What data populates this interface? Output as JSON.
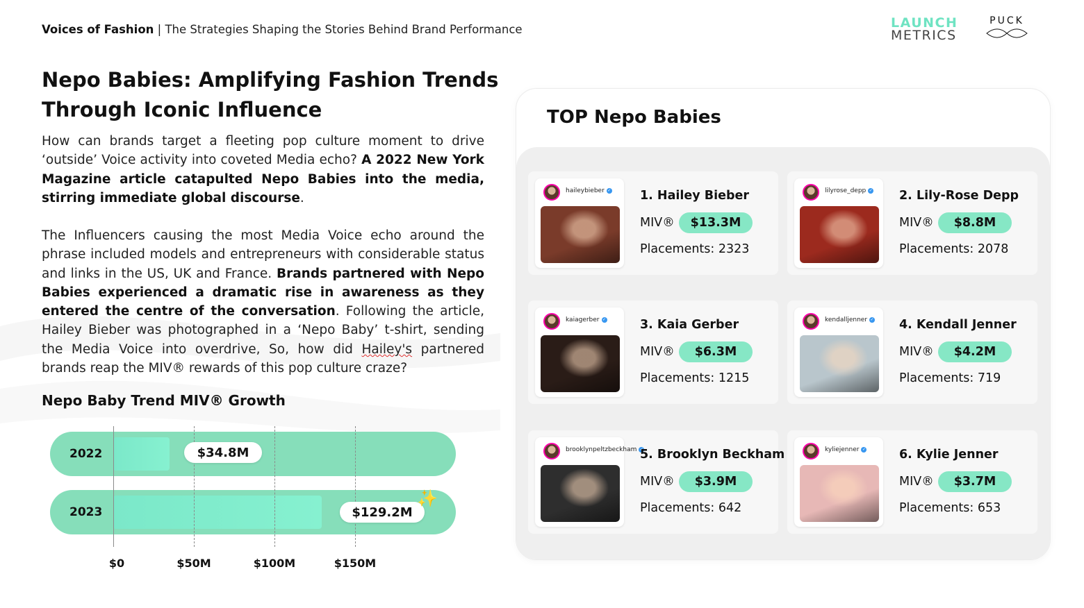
{
  "header": {
    "brand": "Voices of Fashion",
    "separator": " | ",
    "subtitle": "The Strategies Shaping the Stories Behind Brand Performance"
  },
  "logos": {
    "launchmetrics_line1": "LAUNCH",
    "launchmetrics_line2": "METRICS",
    "puck": "PUCK"
  },
  "title_line1": "Nepo Babies: Amplifying Fashion Trends",
  "title_line2": "Through Iconic Influence",
  "para1": {
    "text1": "How can brands target a fleeting pop culture moment to drive ‘outside’ Voice activity into coveted Media echo? ",
    "bold1": "A 2022 New York Magazine article catapulted Nepo Babies into the media, stirring immediate global discourse",
    "text2": "."
  },
  "para2": {
    "text1": "The Influencers causing the most Media Voice echo around the phrase included models and entrepreneurs with considerable status and links in the US, UK and France. ",
    "bold1": "Brands partnered with Nepo Babies experienced a dramatic rise in awareness as they entered the centre of the conversation",
    "text2": ". Following the article, Hailey Bieber was photographed in a ‘Nepo Baby’ t-shirt, sending the Media Voice into overdrive, So, how did ",
    "squiggle": "Hailey's",
    "text3": " partnered brands reap the MIV® rewards of this pop culture craze?"
  },
  "chart_title": "Nepo Baby Trend MIV® Growth",
  "chart_data": {
    "type": "bar",
    "orientation": "horizontal",
    "categories": [
      "2022",
      "2023"
    ],
    "values": [
      34.8,
      129.2
    ],
    "value_labels": [
      "$34.8M",
      "$129.2M"
    ],
    "xlim": [
      0,
      150
    ],
    "x_ticks": [
      0,
      50,
      100,
      150
    ],
    "x_tick_labels": [
      "$0",
      "$50M",
      "$100M",
      "$150M"
    ],
    "unit": "$M"
  },
  "panel": {
    "title": "TOP Nepo Babies",
    "miv_label": "MIV®",
    "influencers": [
      {
        "handle": "haileybieber",
        "name": "1. Hailey Bieber",
        "miv": "$13.3M",
        "placements": "Placements: 2323",
        "photo": "#7a3b2a"
      },
      {
        "handle": "lilyrose_depp",
        "name": "2. Lily-Rose Depp",
        "miv": "$8.8M",
        "placements": "Placements: 2078",
        "photo": "#9c2a1e"
      },
      {
        "handle": "kaiagerber",
        "name": "3. Kaia Gerber",
        "miv": "$6.3M",
        "placements": "Placements: 1215",
        "photo": "#2a1c17"
      },
      {
        "handle": "kendalljenner",
        "name": "4. Kendall Jenner",
        "miv": "$4.2M",
        "placements": "Placements: 719",
        "photo": "#b9c6cc"
      },
      {
        "handle": "brooklynpeltzbeckham",
        "name": "5. Brooklyn Beckham",
        "miv": "$3.9M",
        "placements": "Placements: 642",
        "photo": "#2e2e2e"
      },
      {
        "handle": "kyliejenner",
        "name": "6. Kylie Jenner",
        "miv": "$3.7M",
        "placements": "Placements: 653",
        "photo": "#e7b8b6"
      }
    ]
  }
}
